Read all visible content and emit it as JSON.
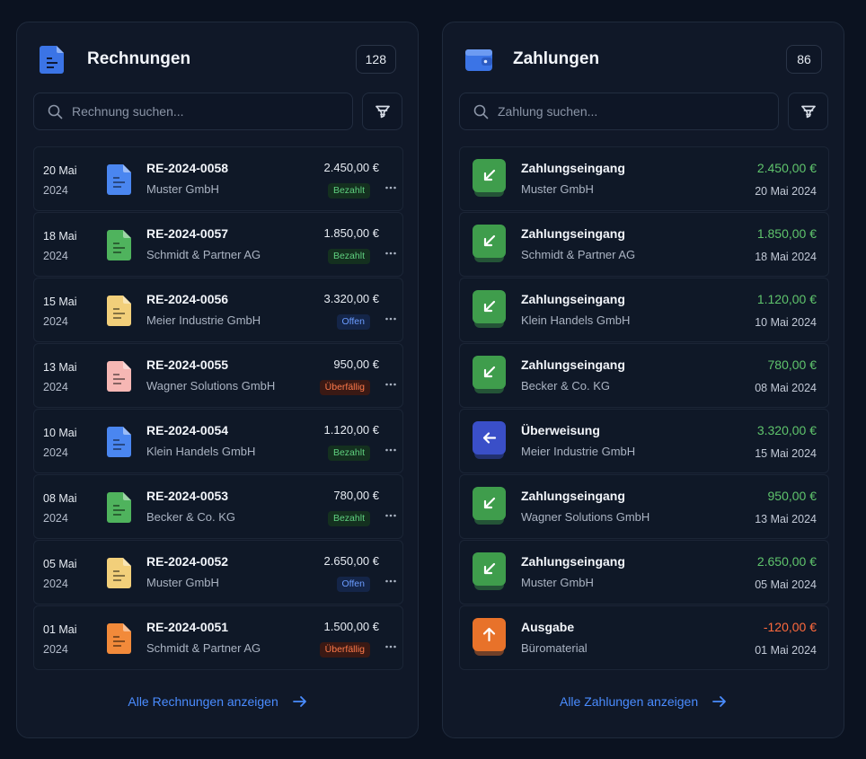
{
  "invoices": {
    "title": "Rechnungen",
    "count": "128",
    "search_placeholder": "Rechnung suchen...",
    "show_all": "Alle Rechnungen anzeigen",
    "items": [
      {
        "day": "20 Mai",
        "year": "2024",
        "number": "RE-2024-0058",
        "customer": "Muster GmbH",
        "amount": "2.450,00 €",
        "status": "Bezahlt",
        "status_type": "paid",
        "icon_color": "#4a86f0"
      },
      {
        "day": "18 Mai",
        "year": "2024",
        "number": "RE-2024-0057",
        "customer": "Schmidt & Partner AG",
        "amount": "1.850,00 €",
        "status": "Bezahlt",
        "status_type": "paid",
        "icon_color": "#4fb35d"
      },
      {
        "day": "15 Mai",
        "year": "2024",
        "number": "RE-2024-0056",
        "customer": "Meier Industrie GmbH",
        "amount": "3.320,00 €",
        "status": "Offen",
        "status_type": "open",
        "icon_color": "#f2cf7a"
      },
      {
        "day": "13 Mai",
        "year": "2024",
        "number": "RE-2024-0055",
        "customer": "Wagner Solutions GmbH",
        "amount": "950,00 €",
        "status": "Überfällig",
        "status_type": "over",
        "icon_color": "#f6b7b4"
      },
      {
        "day": "10 Mai",
        "year": "2024",
        "number": "RE-2024-0054",
        "customer": "Klein Handels GmbH",
        "amount": "1.120,00 €",
        "status": "Bezahlt",
        "status_type": "paid",
        "icon_color": "#4a86f0"
      },
      {
        "day": "08 Mai",
        "year": "2024",
        "number": "RE-2024-0053",
        "customer": "Becker & Co. KG",
        "amount": "780,00 €",
        "status": "Bezahlt",
        "status_type": "paid",
        "icon_color": "#4fb35d"
      },
      {
        "day": "05 Mai",
        "year": "2024",
        "number": "RE-2024-0052",
        "customer": "Muster GmbH",
        "amount": "2.650,00 €",
        "status": "Offen",
        "status_type": "open",
        "icon_color": "#f2cf7a"
      },
      {
        "day": "01 Mai",
        "year": "2024",
        "number": "RE-2024-0051",
        "customer": "Schmidt & Partner AG",
        "amount": "1.500,00 €",
        "status": "Überfällig",
        "status_type": "over",
        "icon_color": "#f28a3a"
      }
    ]
  },
  "payments": {
    "title": "Zahlungen",
    "count": "86",
    "search_placeholder": "Zahlung suchen...",
    "show_all": "Alle Zahlungen anzeigen",
    "items": [
      {
        "title": "Zahlungseingang",
        "sub": "Muster GmbH",
        "amount": "2.450,00 €",
        "date": "20 Mai 2024",
        "kind": "incoming",
        "icon_color": "#3f9d4c"
      },
      {
        "title": "Zahlungseingang",
        "sub": "Schmidt & Partner AG",
        "amount": "1.850,00 €",
        "date": "18 Mai 2024",
        "kind": "incoming",
        "icon_color": "#3f9d4c"
      },
      {
        "title": "Zahlungseingang",
        "sub": "Klein Handels GmbH",
        "amount": "1.120,00 €",
        "date": "10 Mai 2024",
        "kind": "incoming",
        "icon_color": "#3f9d4c"
      },
      {
        "title": "Zahlungseingang",
        "sub": "Becker & Co. KG",
        "amount": "780,00 €",
        "date": "08 Mai 2024",
        "kind": "incoming",
        "icon_color": "#3f9d4c"
      },
      {
        "title": "Überweisung",
        "sub": "Meier Industrie GmbH",
        "amount": "3.320,00 €",
        "date": "15 Mai 2024",
        "kind": "transfer",
        "icon_color": "#3a4fc8"
      },
      {
        "title": "Zahlungseingang",
        "sub": "Wagner Solutions GmbH",
        "amount": "950,00 €",
        "date": "13 Mai 2024",
        "kind": "incoming",
        "icon_color": "#3f9d4c"
      },
      {
        "title": "Zahlungseingang",
        "sub": "Muster GmbH",
        "amount": "2.650,00 €",
        "date": "05 Mai 2024",
        "kind": "incoming",
        "icon_color": "#3f9d4c"
      },
      {
        "title": "Ausgabe",
        "sub": "Büromaterial",
        "amount": "-120,00 €",
        "date": "01 Mai 2024",
        "kind": "outgoing",
        "icon_color": "#e8722a"
      }
    ]
  },
  "colors": {
    "accent": "#4a8cff",
    "positive": "#5fc46c",
    "negative": "#ff6a3d",
    "background": "#0b1220",
    "panel": "#101828"
  }
}
